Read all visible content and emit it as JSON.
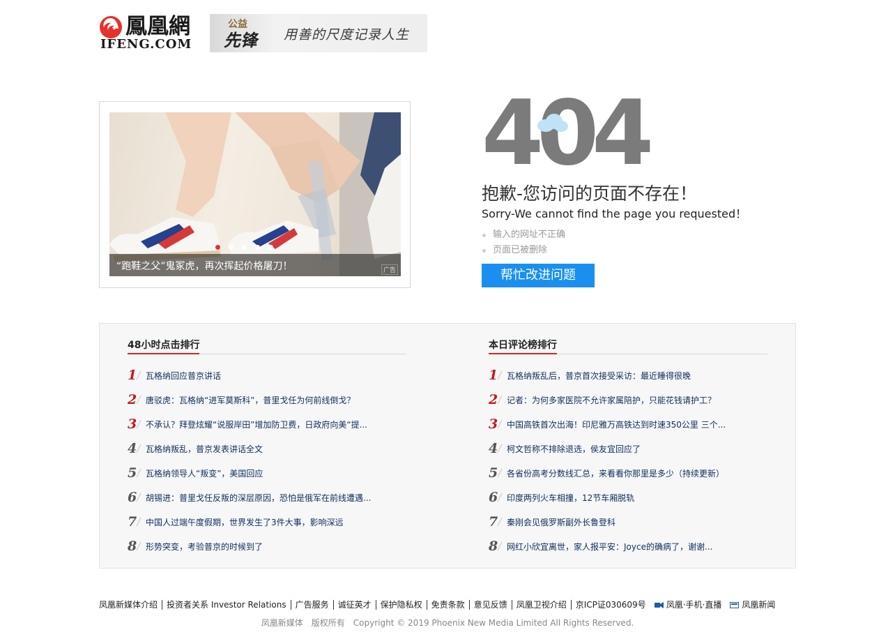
{
  "header": {
    "logo_cn": "鳳凰網",
    "logo_en": "IFENG.COM",
    "banner_brand_top": "公益",
    "banner_brand_main": "先锋",
    "banner_slogan": "用善的尺度记录人生"
  },
  "ad": {
    "caption": "“跑鞋之父”鬼冢虎，再次挥起价格屠刀！",
    "tag": "广告",
    "slide_count": 5,
    "active_slide": 0
  },
  "error": {
    "code": "404",
    "title": "抱歉-您访问的页面不存在！",
    "subtitle": "Sorry-We cannot find the page you requested！",
    "reasons": [
      "输入的网址不正确",
      "页面已被删除"
    ],
    "help_button": "帮忙改进问题"
  },
  "rank_left": {
    "title": "48小时点击排行",
    "items": [
      {
        "num": "1",
        "text": "瓦格纳回应普京讲话"
      },
      {
        "num": "2",
        "text": "唐驳虎：瓦格纳“进军莫斯科”，普里戈任为何前线倒戈？"
      },
      {
        "num": "3",
        "text": "不承认？拜登炫耀“说服岸田”增加防卫费，日政府向美“提..."
      },
      {
        "num": "4",
        "text": "瓦格纳叛乱，普京发表讲话全文"
      },
      {
        "num": "5",
        "text": "瓦格纳领导人“叛变”，美国回应"
      },
      {
        "num": "6",
        "text": "胡锡进：普里戈任反叛的深层原因，恐怕是俄军在前线遭遇..."
      },
      {
        "num": "7",
        "text": "中国人过端午度假期，世界发生了3件大事，影响深远"
      },
      {
        "num": "8",
        "text": "形势突变，考验普京的时候到了"
      }
    ]
  },
  "rank_right": {
    "title": "本日评论榜排行",
    "items": [
      {
        "num": "1",
        "text": "瓦格纳叛乱后，普京首次接受采访：最近睡得很晚"
      },
      {
        "num": "2",
        "text": "记者：为何多家医院不允许家属陪护，只能花钱请护工？"
      },
      {
        "num": "3",
        "text": "中国高铁首次出海！印尼雅万高铁达到时速350公里 三个..."
      },
      {
        "num": "4",
        "text": "柯文哲称不排除退选，侯友宜回应了"
      },
      {
        "num": "5",
        "text": "各省份高考分数线汇总，来看看你那里是多少（持续更新）"
      },
      {
        "num": "6",
        "text": "印度两列火车相撞，12节车厢脱轨"
      },
      {
        "num": "7",
        "text": "秦刚会见俄罗斯副外长鲁登科"
      },
      {
        "num": "8",
        "text": "网红小欣宜离世，家人报平安：Joyce的确病了，谢谢..."
      }
    ]
  },
  "footer": {
    "links": [
      "凤凰新媒体介绍",
      "投资者关系 Investor Relations",
      "广告服务",
      "诚征英才",
      "保护隐私权",
      "免责条款",
      "意见反馈",
      "凤凰卫视介绍",
      "京ICP证030609号"
    ],
    "live_link": "凤凰·手机·直播",
    "app_link": "凤凰新闻",
    "copyright_owner": "凤凰新媒体",
    "copyright_rights": "版权所有",
    "copyright_text": "Copyright © 2019 Phoenix New Media Limited All Rights Reserved."
  },
  "colors": {
    "accent_blue": "#1a8ff0",
    "rank_red": "#c8161d",
    "link_blue": "#0e2e5c"
  }
}
